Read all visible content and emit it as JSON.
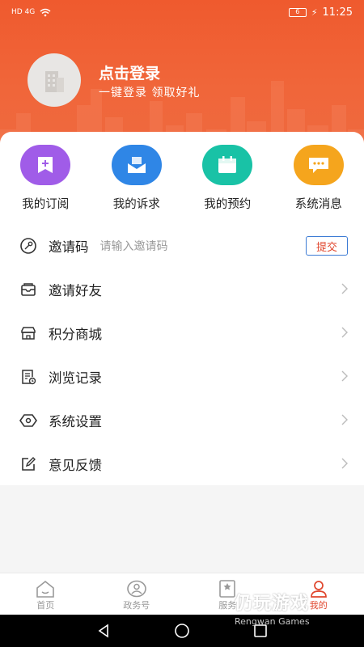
{
  "status_bar": {
    "left_text": "HD 4G",
    "battery": "6",
    "time": "11:25"
  },
  "header": {
    "login_title": "点击登录",
    "login_subtitle": "一键登录  领取好礼"
  },
  "quick_actions": [
    {
      "label": "我的订阅",
      "icon": "bookmark-add-icon",
      "color": "#a05ce8"
    },
    {
      "label": "我的诉求",
      "icon": "mail-icon",
      "color": "#2f86e6"
    },
    {
      "label": "我的预约",
      "icon": "calendar-icon",
      "color": "#19c2a6"
    },
    {
      "label": "系统消息",
      "icon": "message-icon",
      "color": "#f5a51d"
    }
  ],
  "invite": {
    "label": "邀请码",
    "placeholder": "请输入邀请码",
    "submit": "提交"
  },
  "menu": [
    {
      "label": "邀请好友",
      "icon": "invite-icon"
    },
    {
      "label": "积分商城",
      "icon": "store-icon"
    },
    {
      "label": "浏览记录",
      "icon": "history-icon"
    },
    {
      "label": "系统设置",
      "icon": "settings-icon"
    },
    {
      "label": "意见反馈",
      "icon": "feedback-icon"
    }
  ],
  "tabs": [
    {
      "label": "首页",
      "icon": "home-icon"
    },
    {
      "label": "政务号",
      "icon": "gov-account-icon"
    },
    {
      "label": "服务",
      "icon": "service-icon"
    },
    {
      "label": "我的",
      "icon": "user-icon",
      "active": true
    }
  ],
  "watermark": {
    "main": "仍玩游戏",
    "sub": "Rengwan Games"
  },
  "colors": {
    "accent": "#e0462d",
    "header": "#ef5a2e"
  }
}
